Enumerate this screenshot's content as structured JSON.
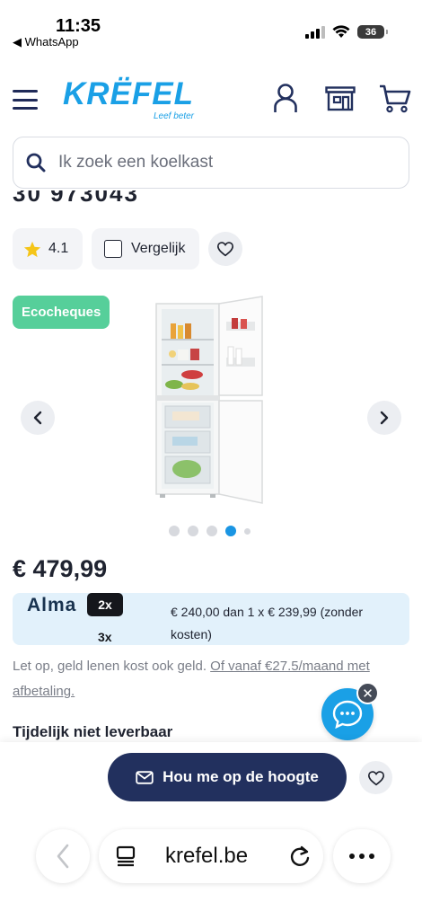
{
  "status_bar": {
    "time": "11:35",
    "back_app": "◀ WhatsApp",
    "battery": "36"
  },
  "header": {
    "logo_text": "KRËFEL",
    "logo_tagline": "Leef beter"
  },
  "search": {
    "placeholder": "Ik zoek een koelkast"
  },
  "partial_heading": "30 973043",
  "product": {
    "rating": "4.1",
    "compare_label": "Vergelijk",
    "badge": "Ecocheques",
    "carousel_total": 5,
    "carousel_active_index": 4,
    "price": "€ 479,99"
  },
  "alma": {
    "logo": "Alma",
    "option_2x": "2x",
    "option_3x": "3x",
    "installment_text": "€ 240,00 dan 1 x € 239,99 (zonder kosten)"
  },
  "legal": {
    "text": "Let op, geld lenen kost ook geld. ",
    "link_text": "Of vanaf €27.5/maand met afbetaling."
  },
  "availability": "Tijdelijk niet leverbaar",
  "cta": {
    "notify_label": "Hou me op de hoogte"
  },
  "browser": {
    "url": "krefel.be"
  },
  "colors": {
    "brand_blue": "#1aa0e6",
    "navy": "#22305e",
    "eco_green": "#56cf9a",
    "alma_bg": "#e2f1fb"
  }
}
